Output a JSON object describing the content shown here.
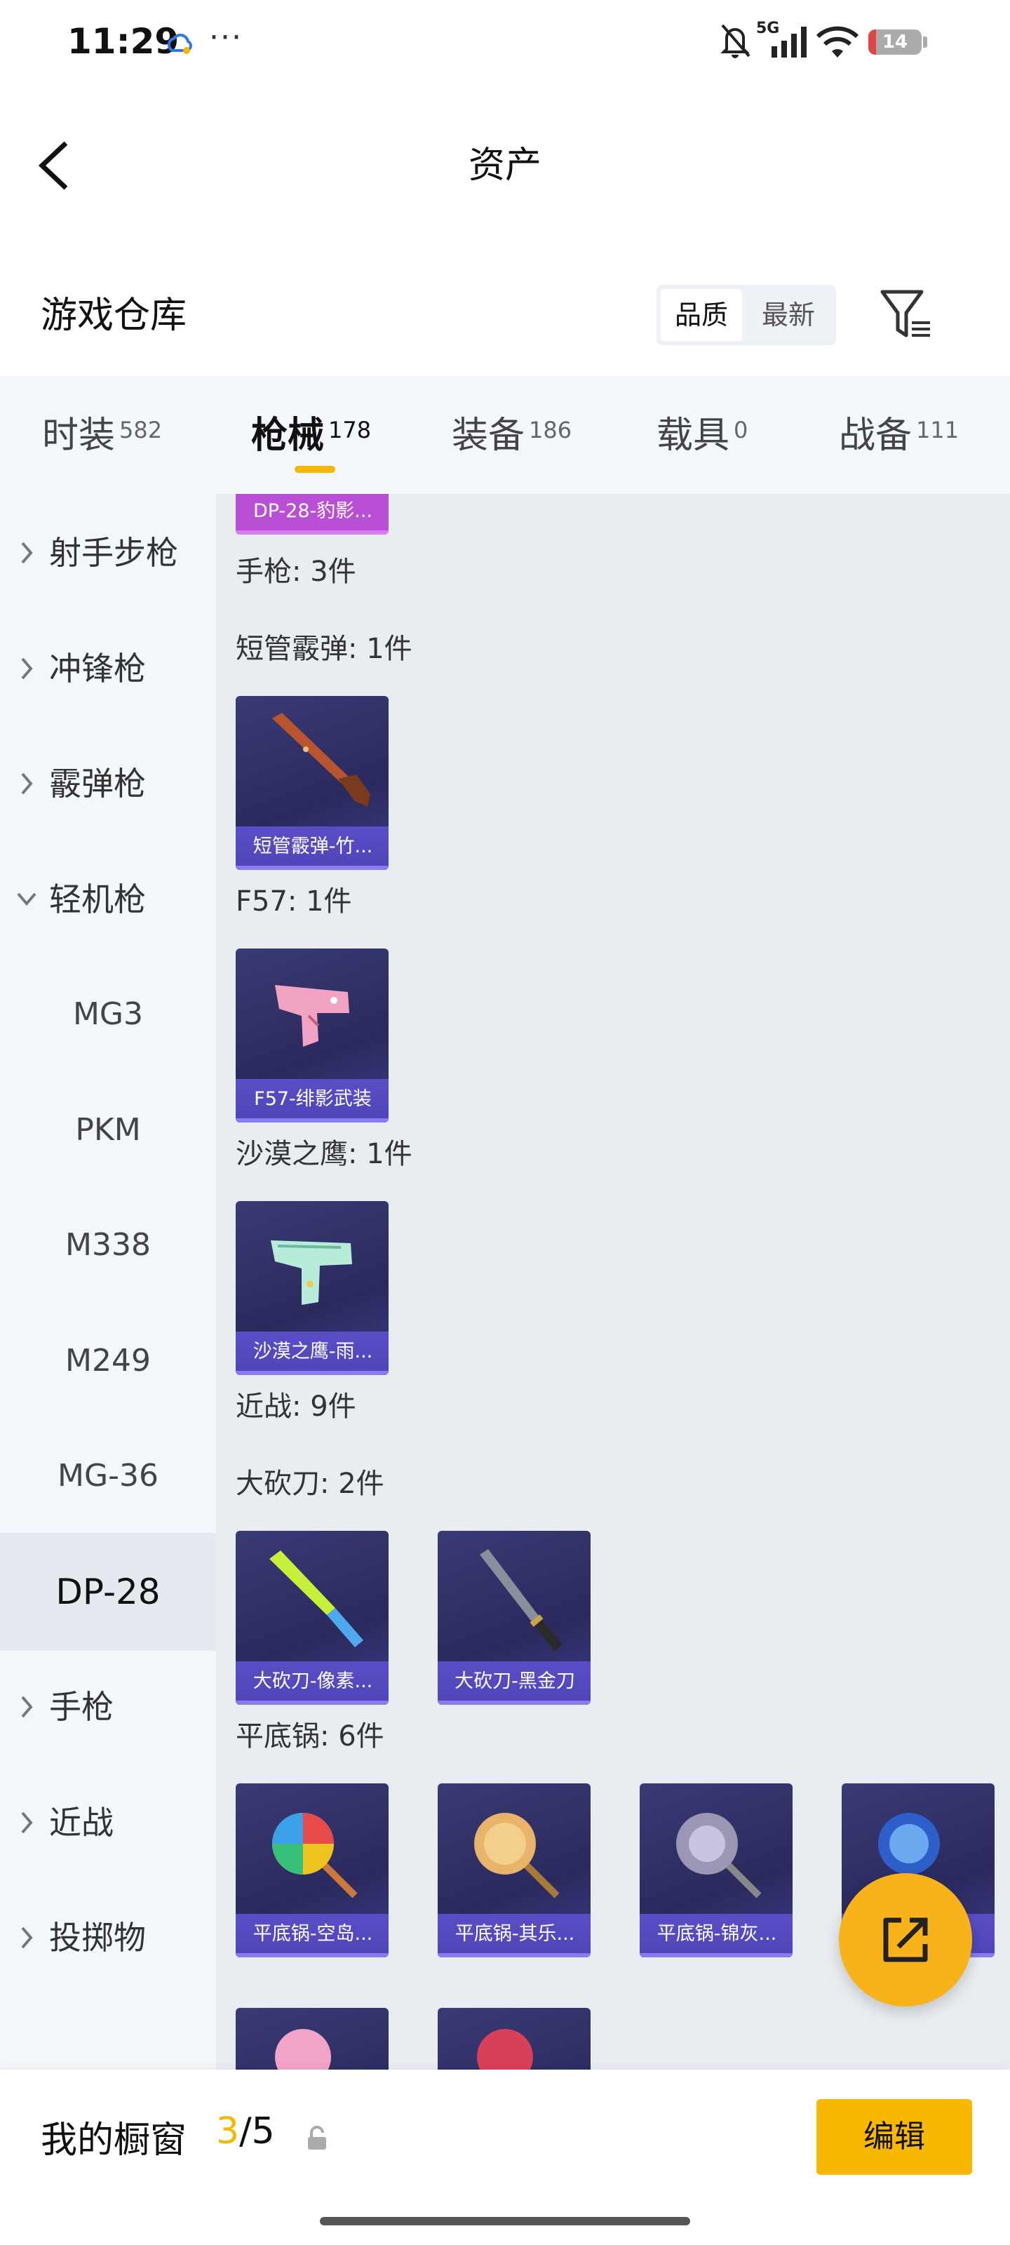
{
  "status_bar": {
    "time": "11:29",
    "overflow": "···",
    "signal_label": "5G",
    "battery": "14",
    "battery_level": 0.14,
    "icons": [
      "cloud-sync-icon",
      "bell-muted-icon",
      "signal-5g-icon",
      "wifi-icon",
      "battery-icon"
    ]
  },
  "nav": {
    "title": "资产",
    "back_icon": "chevron-left-icon"
  },
  "warehouse": {
    "title": "游戏仓库",
    "sort_options": [
      "品质",
      "最新"
    ],
    "sort_selected": "品质",
    "filter_icon": "filter-icon"
  },
  "tabs": [
    {
      "label": "时装",
      "count": "582"
    },
    {
      "label": "枪械",
      "count": "178",
      "active": true
    },
    {
      "label": "装备",
      "count": "186"
    },
    {
      "label": "载具",
      "count": "0"
    },
    {
      "label": "战备",
      "count": "111"
    }
  ],
  "sidebar": {
    "items": [
      {
        "label": "射手步枪",
        "type": "parent",
        "expanded": false
      },
      {
        "label": "冲锋枪",
        "type": "parent",
        "expanded": false
      },
      {
        "label": "霰弹枪",
        "type": "parent",
        "expanded": false
      },
      {
        "label": "轻机枪",
        "type": "parent",
        "expanded": true
      },
      {
        "label": "MG3",
        "type": "child"
      },
      {
        "label": "PKM",
        "type": "child"
      },
      {
        "label": "M338",
        "type": "child"
      },
      {
        "label": "M249",
        "type": "child"
      },
      {
        "label": "MG-36",
        "type": "child"
      },
      {
        "label": "DP-28",
        "type": "child",
        "selected": true
      },
      {
        "label": "手枪",
        "type": "parent",
        "expanded": false
      },
      {
        "label": "近战",
        "type": "parent",
        "expanded": false
      },
      {
        "label": "投掷物",
        "type": "parent",
        "expanded": false
      }
    ]
  },
  "content": {
    "top_card": {
      "name": "DP-28-豹影..."
    },
    "sections": [
      {
        "heading": "手枪: 3件"
      },
      {
        "heading": "短管霰弹: 1件",
        "cards": [
          {
            "name": "短管霰弹-竹...",
            "art": "sawed-off-shotgun-icon"
          }
        ]
      },
      {
        "heading": "F57: 1件",
        "cards": [
          {
            "name": "F57-绯影武装",
            "art": "pistol-icon"
          }
        ]
      },
      {
        "heading": "沙漠之鹰: 1件",
        "cards": [
          {
            "name": "沙漠之鹰-雨...",
            "art": "desert-eagle-icon"
          }
        ]
      },
      {
        "heading": "近战: 9件"
      },
      {
        "heading": "大砍刀: 2件",
        "cards": [
          {
            "name": "大砍刀-像素...",
            "art": "machete-icon"
          },
          {
            "name": "大砍刀-黑金刀",
            "art": "machete-icon"
          }
        ]
      },
      {
        "heading": "平底锅: 6件",
        "cards": [
          {
            "name": "平底锅-空岛...",
            "art": "pan-icon"
          },
          {
            "name": "平底锅-其乐...",
            "art": "pan-icon"
          },
          {
            "name": "平底锅-锦灰...",
            "art": "pan-icon"
          },
          {
            "name": "",
            "art": "pan-icon"
          }
        ]
      }
    ]
  },
  "fab": {
    "icon": "share-external-icon"
  },
  "footer": {
    "title": "我的橱窗",
    "current": "3",
    "separator": "/",
    "total": "5",
    "lock_icon": "lock-icon",
    "edit_label": "编辑"
  },
  "colors": {
    "accent": "#f5b800",
    "card_bg": "#2f2e66",
    "card_label_bg": "#5046bc",
    "content_bg": "#e9edf2",
    "sidebar_bg": "#f3f6fa"
  }
}
